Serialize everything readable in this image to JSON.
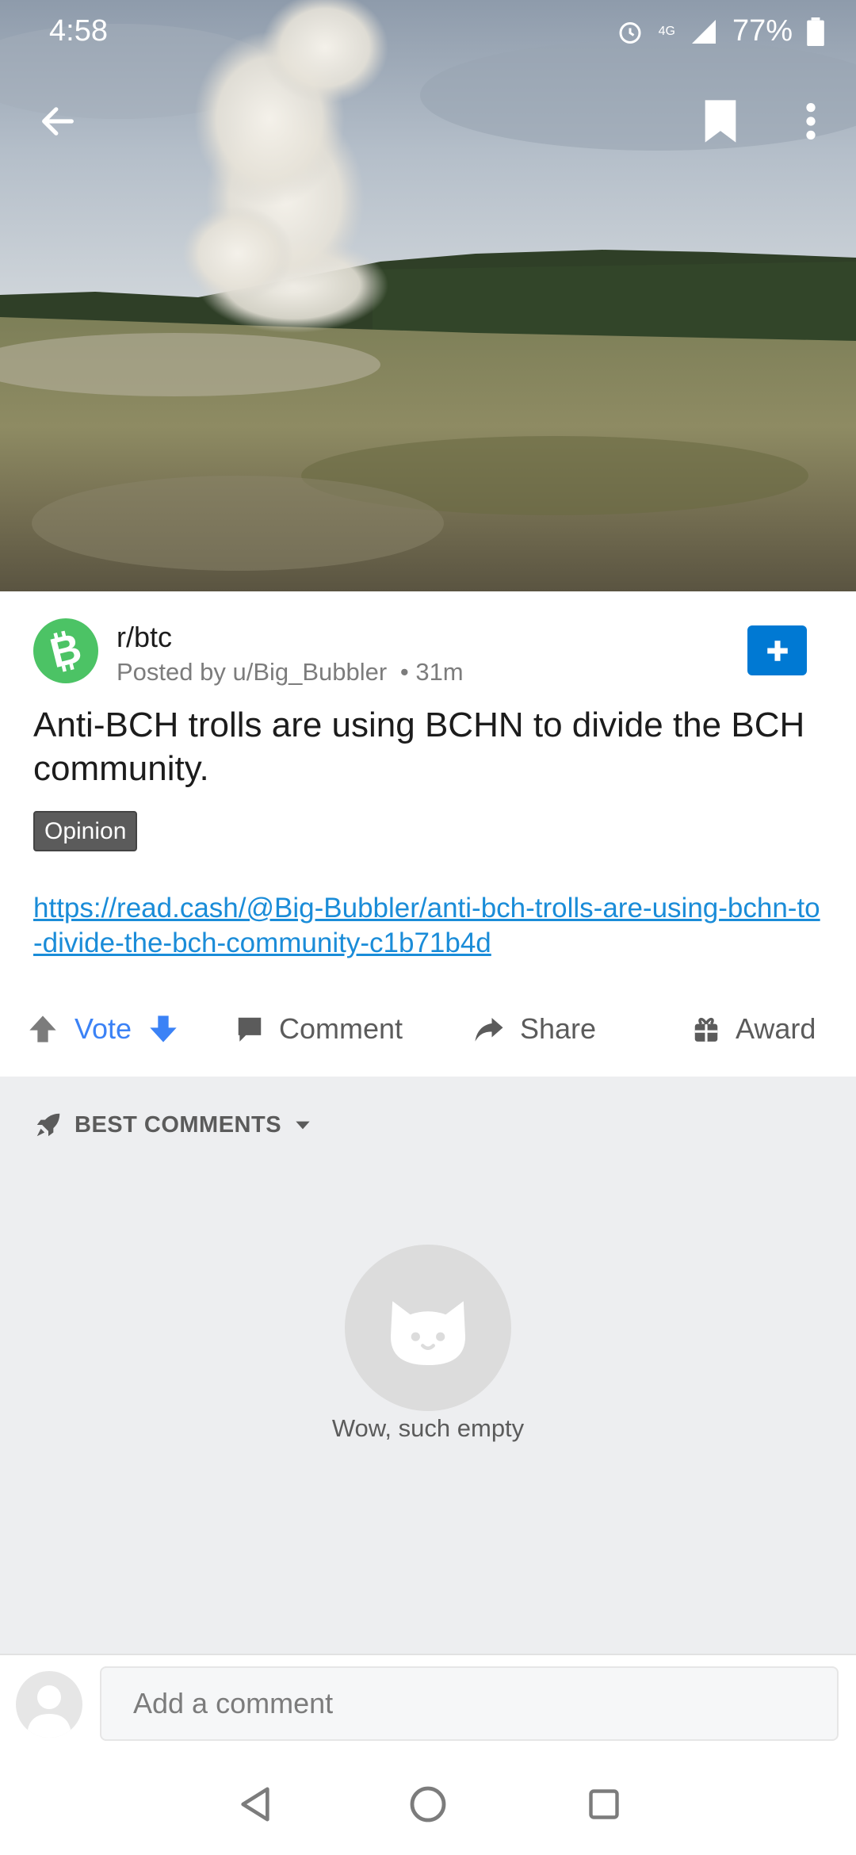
{
  "status_bar": {
    "time": "4:58",
    "network": "4G",
    "battery": "77%"
  },
  "post": {
    "subreddit": "r/btc",
    "posted_by": "Posted by u/Big_Bubbler",
    "age": "• 31m",
    "title": "Anti-BCH trolls are using BCHN to divide the BCH community.",
    "flair": "Opinion",
    "link": "https://read.cash/@Big-Bubbler/anti-bch-trolls-are-using-bchn-to-divide-the-bch-community-c1b71b4d"
  },
  "actions": {
    "vote": "Vote",
    "comment": "Comment",
    "share": "Share",
    "award": "Award"
  },
  "comments": {
    "sort_label": "BEST COMMENTS",
    "empty_text": "Wow, such empty"
  },
  "comment_bar": {
    "placeholder": "Add a comment"
  },
  "colors": {
    "accent": "#0079d3",
    "vote": "#3b82f6",
    "bch_green": "#4cc365",
    "link": "#1a8cd8"
  },
  "icons": [
    "back-arrow-icon",
    "bookmark-icon",
    "more-vertical-icon",
    "bitcoin-cash-icon",
    "plus-icon",
    "upvote-icon",
    "downvote-icon",
    "comment-icon",
    "share-icon",
    "award-icon",
    "rocket-icon",
    "chevron-down-icon",
    "cat-icon",
    "user-icon",
    "nav-back-icon",
    "nav-home-icon",
    "nav-recents-icon"
  ]
}
